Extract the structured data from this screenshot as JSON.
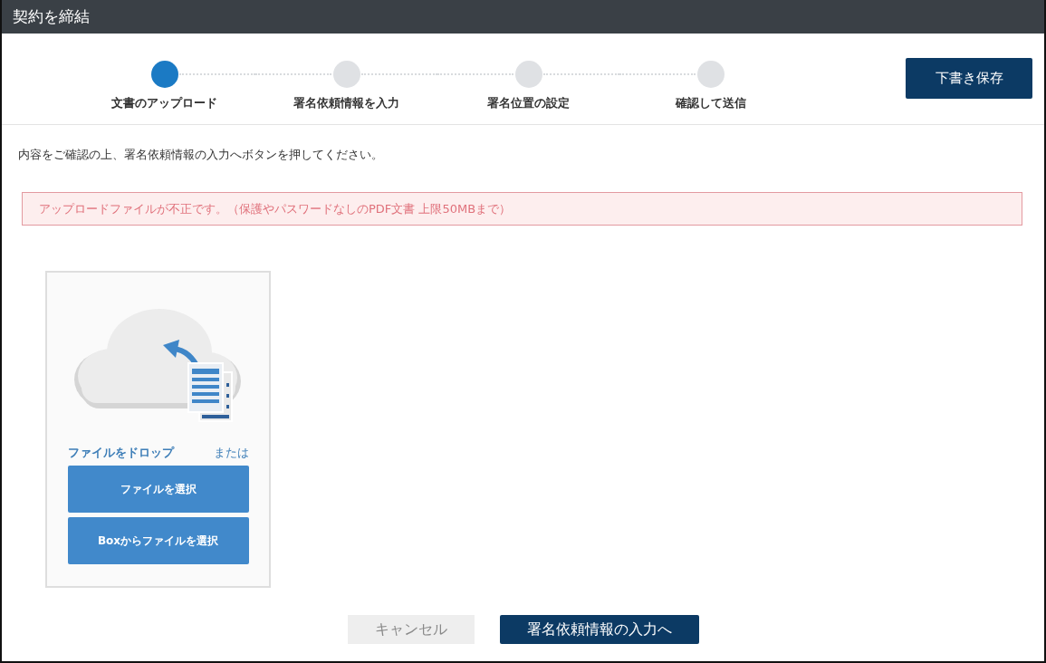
{
  "window": {
    "title": "契約を締結"
  },
  "steps": [
    {
      "label": "文書のアップロード",
      "selected": true
    },
    {
      "label": "署名依頼情報を入力",
      "selected": false
    },
    {
      "label": "署名位置の設定",
      "selected": false
    },
    {
      "label": "確認して送信",
      "selected": false
    }
  ],
  "save_draft_button": "下書き保存",
  "instruction": "内容をご確認の上、署名依頼情報の入力へボタンを押してください。",
  "error_message": "アップロードファイルが不正です。（保護やパスワードなしのPDF文書 上限50MBまで）",
  "upload": {
    "drop_label": "ファイルをドロップ",
    "or_label": "または",
    "buttons": [
      "ファイルを選択",
      "Boxからファイルを選択"
    ]
  },
  "footer_buttons": {
    "cancel": "キャンセル",
    "next": "署名依頼情報の入力へ"
  }
}
